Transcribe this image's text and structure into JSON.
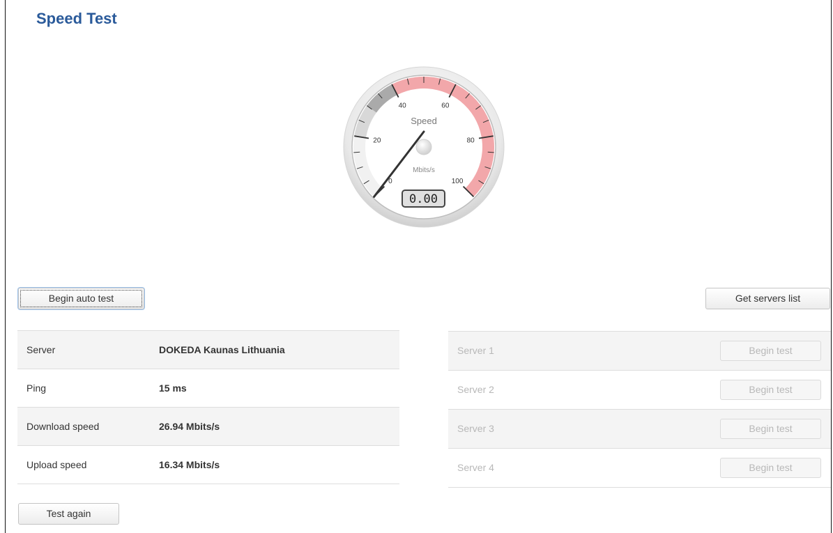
{
  "page": {
    "title": "Speed Test"
  },
  "gauge": {
    "title": "Speed",
    "units": "Mbits/s",
    "ticks": [
      "0",
      "20",
      "40",
      "60",
      "80",
      "100"
    ],
    "min": 0,
    "max": 100,
    "readout": "0.00",
    "needle_value": 0,
    "colors": {
      "face": "#ffffff",
      "band_gray": "#aaaaaa",
      "band_red": "#f2a7aa",
      "needle": "#333333"
    }
  },
  "actions": {
    "begin_auto_test": "Begin auto test",
    "get_servers_list": "Get servers list",
    "test_again": "Test again"
  },
  "results": [
    {
      "label": "Server",
      "value": "DOKEDA Kaunas Lithuania"
    },
    {
      "label": "Ping",
      "value": "15 ms"
    },
    {
      "label": "Download speed",
      "value": "26.94 Mbits/s"
    },
    {
      "label": "Upload speed",
      "value": "16.34 Mbits/s"
    }
  ],
  "servers": [
    {
      "name": "Server 1",
      "button": "Begin test"
    },
    {
      "name": "Server 2",
      "button": "Begin test"
    },
    {
      "name": "Server 3",
      "button": "Begin test"
    },
    {
      "name": "Server 4",
      "button": "Begin test"
    }
  ]
}
